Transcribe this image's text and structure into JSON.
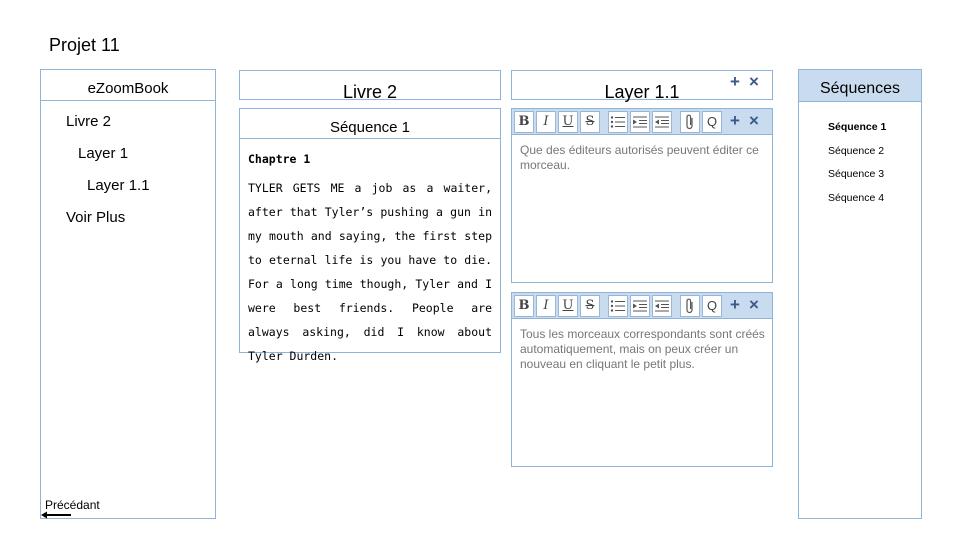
{
  "project": {
    "title": "Projet 11"
  },
  "sidebar": {
    "title": "eZoomBook",
    "items": [
      {
        "label": "Livre 2"
      },
      {
        "label": "Layer 1"
      },
      {
        "label": "Layer 1.1"
      },
      {
        "label": "Voir Plus"
      }
    ],
    "back_label": "Précédant"
  },
  "book": {
    "title": "Livre 2",
    "sequence_title": "Séquence 1",
    "chapter_title": "Chaptre 1",
    "chapter_text": "TYLER GETS ME a job as a waiter, after that Tyler’s pushing a gun in my mouth and saying, the first step to eternal life is you have to die. For a long time though, Tyler and I were best friends. People are always asking, did I know about Tyler Durden."
  },
  "layer": {
    "title": "Layer 1.1",
    "editors": [
      {
        "placeholder": "Que des éditeurs autorisés peuvent éditer ce morceau."
      },
      {
        "placeholder": "Tous les morceaux correspondants sont créés automatiquement, mais on peux créer un nouveau en cliquant le petit plus."
      }
    ],
    "toolbar": {
      "bold": "B",
      "italic": "I",
      "underline": "U",
      "strike": "S",
      "search": "Q",
      "add": "+",
      "close": "×",
      "icons": [
        "bold-icon",
        "italic-icon",
        "underline-icon",
        "strikethrough-icon",
        "bulleted-list-icon",
        "indent-icon",
        "outdent-icon",
        "paperclip-icon",
        "search-icon",
        "plus-icon",
        "close-icon"
      ]
    }
  },
  "sequences": {
    "title": "Séquences",
    "items": [
      {
        "label": "Séquence 1",
        "active": true
      },
      {
        "label": "Séquence 2",
        "active": false
      },
      {
        "label": "Séquence 3",
        "active": false
      },
      {
        "label": "Séquence 4",
        "active": false
      }
    ]
  },
  "colors": {
    "border": "#8fb4d9",
    "accent_fill": "#c9dcef",
    "icon": "#3c5a8a",
    "placeholder_text": "#777777"
  }
}
